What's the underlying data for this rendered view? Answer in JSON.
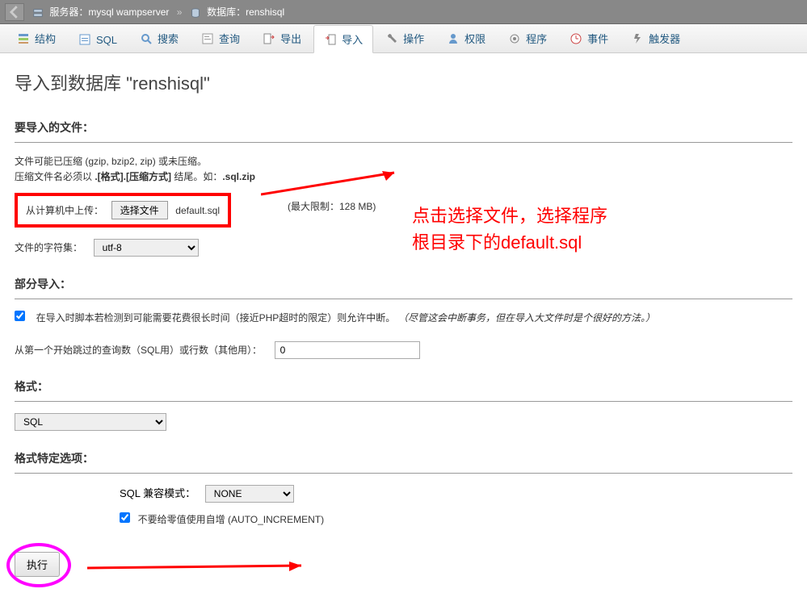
{
  "topbar": {
    "server_prefix": "服务器：",
    "server": "mysql wampserver",
    "db_prefix": "数据库：",
    "db": "renshisql"
  },
  "tabs": [
    {
      "label": "结构",
      "icon": "structure"
    },
    {
      "label": "SQL",
      "icon": "sql"
    },
    {
      "label": "搜索",
      "icon": "search"
    },
    {
      "label": "查询",
      "icon": "query"
    },
    {
      "label": "导出",
      "icon": "export"
    },
    {
      "label": "导入",
      "icon": "import"
    },
    {
      "label": "操作",
      "icon": "wrench"
    },
    {
      "label": "权限",
      "icon": "privs"
    },
    {
      "label": "程序",
      "icon": "routines"
    },
    {
      "label": "事件",
      "icon": "events"
    },
    {
      "label": "触发器",
      "icon": "triggers"
    }
  ],
  "active_tab": 5,
  "page_title": "导入到数据库 \"renshisql\"",
  "sections": {
    "file": {
      "title": "要导入的文件：",
      "compress_note": "文件可能已压缩 (gzip, bzip2, zip) 或未压缩。",
      "naming_note_a": "压缩文件名必须以 ",
      "naming_note_b": ".[格式].[压缩方式]",
      "naming_note_c": " 结尾。如：",
      "naming_note_d": ".sql.zip",
      "upload_label": "从计算机中上传：",
      "choose_file": "选择文件",
      "chosen_file": "default.sql",
      "max_limit": "(最大限制：128 MB)",
      "charset_label": "文件的字符集：",
      "charset_value": "utf-8"
    },
    "partial": {
      "title": "部分导入：",
      "interrupt_label": "在导入时脚本若检测到可能需要花费很长时间（接近PHP超时的限定）则允许中断。",
      "interrupt_note": "（尽管这会中断事务，但在导入大文件时是个很好的方法。）",
      "skip_label": "从第一个开始跳过的查询数（SQL用）或行数（其他用）：",
      "skip_value": "0"
    },
    "format": {
      "title": "格式：",
      "value": "SQL"
    },
    "format_opts": {
      "title": "格式特定选项：",
      "compat_label": "SQL 兼容模式：",
      "compat_value": "NONE",
      "autoinc_label": "不要给零值使用自增 (AUTO_INCREMENT)"
    },
    "execute": "执行"
  },
  "annotation": {
    "line1": "点击选择文件，选择程序",
    "line2": "根目录下的default.sql"
  }
}
